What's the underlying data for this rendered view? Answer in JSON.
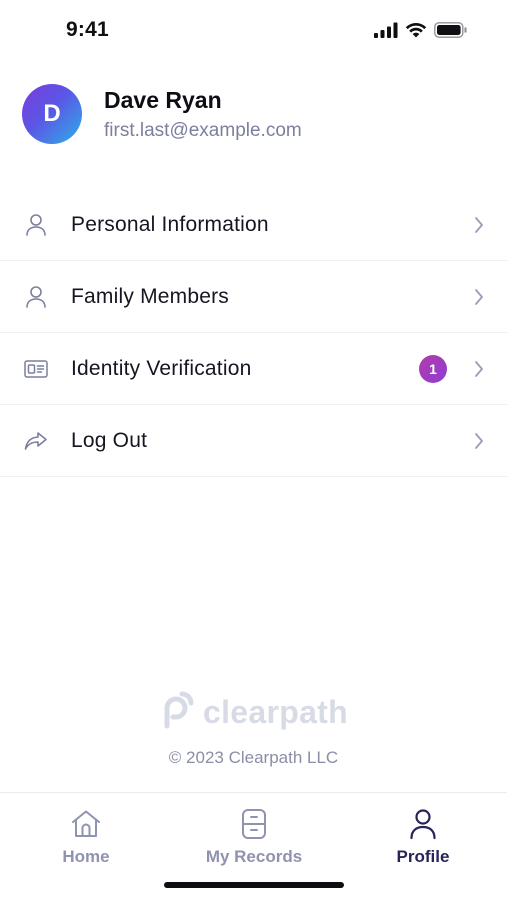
{
  "status_bar": {
    "time": "9:41"
  },
  "profile": {
    "avatar_initial": "D",
    "name": "Dave Ryan",
    "email": "first.last@example.com"
  },
  "menu": {
    "items": [
      {
        "label": "Personal Information",
        "icon": "person-icon"
      },
      {
        "label": "Family Members",
        "icon": "person-icon"
      },
      {
        "label": "Identity Verification",
        "icon": "id-card-icon",
        "badge": "1"
      },
      {
        "label": "Log Out",
        "icon": "share-arrow-icon"
      }
    ]
  },
  "footer": {
    "brand_name": "clearpath",
    "copyright": "© 2023 Clearpath LLC"
  },
  "tab_bar": {
    "tabs": [
      {
        "label": "Home",
        "icon": "home-icon",
        "active": false
      },
      {
        "label": "My Records",
        "icon": "records-icon",
        "active": false
      },
      {
        "label": "Profile",
        "icon": "profile-icon",
        "active": true
      }
    ]
  },
  "colors": {
    "accent": "#262458",
    "muted": "#8f93b0",
    "badge": "#a63dc4",
    "avatar_start": "#7a3bdb",
    "avatar_end": "#2fb0e6"
  }
}
